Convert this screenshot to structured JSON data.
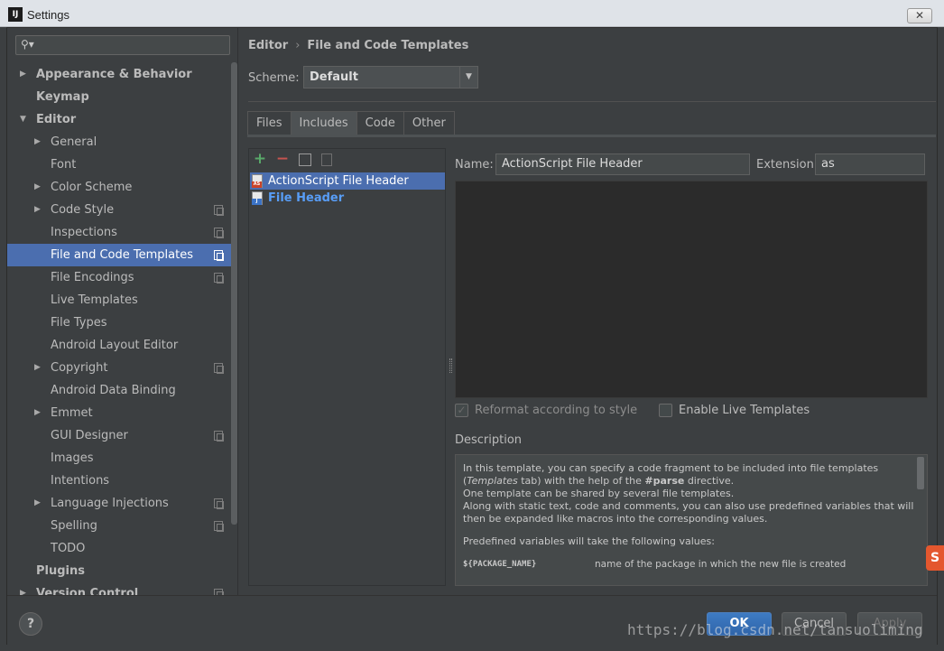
{
  "window": {
    "title": "Settings",
    "app_icon": "IJ",
    "close_label": "✕"
  },
  "sidebar": {
    "search_placeholder": "",
    "items": [
      {
        "label": "Appearance & Behavior",
        "level": 0,
        "arrow": "▶",
        "bold": true,
        "copy": false,
        "selected": false
      },
      {
        "label": "Keymap",
        "level": 0,
        "arrow": "",
        "bold": true,
        "copy": false,
        "selected": false
      },
      {
        "label": "Editor",
        "level": 0,
        "arrow": "▼",
        "bold": true,
        "copy": false,
        "selected": false
      },
      {
        "label": "General",
        "level": 1,
        "arrow": "▶",
        "bold": false,
        "copy": false,
        "selected": false
      },
      {
        "label": "Font",
        "level": 1,
        "arrow": "",
        "bold": false,
        "copy": false,
        "selected": false
      },
      {
        "label": "Color Scheme",
        "level": 1,
        "arrow": "▶",
        "bold": false,
        "copy": false,
        "selected": false
      },
      {
        "label": "Code Style",
        "level": 1,
        "arrow": "▶",
        "bold": false,
        "copy": true,
        "selected": false
      },
      {
        "label": "Inspections",
        "level": 1,
        "arrow": "",
        "bold": false,
        "copy": true,
        "selected": false
      },
      {
        "label": "File and Code Templates",
        "level": 1,
        "arrow": "",
        "bold": false,
        "copy": true,
        "selected": true
      },
      {
        "label": "File Encodings",
        "level": 1,
        "arrow": "",
        "bold": false,
        "copy": true,
        "selected": false
      },
      {
        "label": "Live Templates",
        "level": 1,
        "arrow": "",
        "bold": false,
        "copy": false,
        "selected": false
      },
      {
        "label": "File Types",
        "level": 1,
        "arrow": "",
        "bold": false,
        "copy": false,
        "selected": false
      },
      {
        "label": "Android Layout Editor",
        "level": 1,
        "arrow": "",
        "bold": false,
        "copy": false,
        "selected": false
      },
      {
        "label": "Copyright",
        "level": 1,
        "arrow": "▶",
        "bold": false,
        "copy": true,
        "selected": false
      },
      {
        "label": "Android Data Binding",
        "level": 1,
        "arrow": "",
        "bold": false,
        "copy": false,
        "selected": false
      },
      {
        "label": "Emmet",
        "level": 1,
        "arrow": "▶",
        "bold": false,
        "copy": false,
        "selected": false
      },
      {
        "label": "GUI Designer",
        "level": 1,
        "arrow": "",
        "bold": false,
        "copy": true,
        "selected": false
      },
      {
        "label": "Images",
        "level": 1,
        "arrow": "",
        "bold": false,
        "copy": false,
        "selected": false
      },
      {
        "label": "Intentions",
        "level": 1,
        "arrow": "",
        "bold": false,
        "copy": false,
        "selected": false
      },
      {
        "label": "Language Injections",
        "level": 1,
        "arrow": "▶",
        "bold": false,
        "copy": true,
        "selected": false
      },
      {
        "label": "Spelling",
        "level": 1,
        "arrow": "",
        "bold": false,
        "copy": true,
        "selected": false
      },
      {
        "label": "TODO",
        "level": 1,
        "arrow": "",
        "bold": false,
        "copy": false,
        "selected": false
      },
      {
        "label": "Plugins",
        "level": 0,
        "arrow": "",
        "bold": true,
        "copy": false,
        "selected": false
      },
      {
        "label": "Version Control",
        "level": 0,
        "arrow": "▶",
        "bold": true,
        "copy": true,
        "selected": false
      }
    ]
  },
  "breadcrumb": {
    "part1": "Editor",
    "separator": "›",
    "part2": "File and Code Templates"
  },
  "scheme": {
    "label": "Scheme:",
    "value": "Default",
    "dropdown": "▼"
  },
  "tabs": [
    {
      "label": "Files",
      "active": false
    },
    {
      "label": "Includes",
      "active": true
    },
    {
      "label": "Code",
      "active": false
    },
    {
      "label": "Other",
      "active": false
    }
  ],
  "toolbar": {
    "add": "+",
    "remove": "−"
  },
  "templates": [
    {
      "label": "ActionScript File Header",
      "badge": "AS",
      "selected": true
    },
    {
      "label": "File Header",
      "badge": "J",
      "selected": false
    }
  ],
  "editor": {
    "name_label": "Name:",
    "name_value": "ActionScript File Header",
    "extension_label": "Extension:",
    "extension_value": "as",
    "reformat_label": "Reformat according to style",
    "reformat_checked": true,
    "live_templates_label": "Enable Live Templates",
    "live_templates_checked": false
  },
  "description": {
    "label": "Description",
    "p1_a": "In this template, you can specify a code fragment to be included into file templates (",
    "p1_italic": "Templates",
    "p1_b": " tab) with the help of the ",
    "p1_bold": "#parse",
    "p1_c": " directive.",
    "p2": "One template can be shared by several file templates.",
    "p3": "Along with static text, code and comments, you can also use predefined variables that will then be expanded like macros into the corresponding values.",
    "p4": "Predefined variables will take the following values:",
    "var_name": "${PACKAGE_NAME}",
    "var_desc": "name of the package in which the new file is created"
  },
  "buttons": {
    "help": "?",
    "ok": "OK",
    "cancel": "Cancel",
    "apply": "Apply"
  },
  "watermark": "https://blog.csdn.net/tansuoliming",
  "corner_badge": "S"
}
